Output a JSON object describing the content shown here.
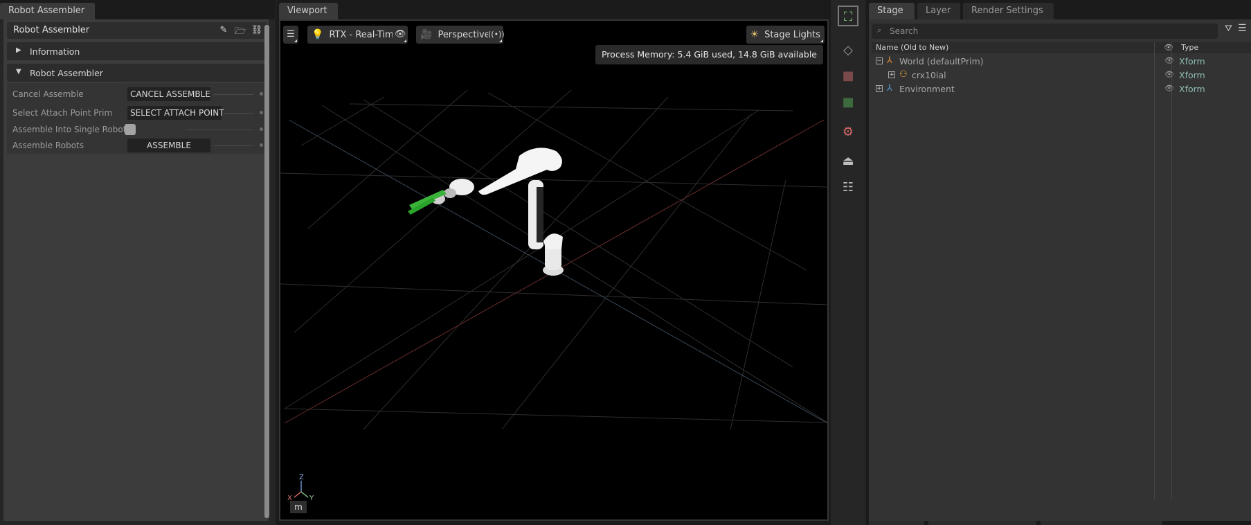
{
  "left_panel": {
    "tab": "Robot Assembler",
    "title": "Robot Assembler",
    "icons": [
      "edit-icon",
      "folder-open-icon",
      "link-icon"
    ],
    "sections": {
      "information": "Information",
      "robot_assembler": "Robot Assembler"
    },
    "rows": [
      {
        "label": "Cancel Assemble",
        "button": "CANCEL ASSEMBLE"
      },
      {
        "label": "Select Attach Point Prim",
        "button": "SELECT ATTACH POINT"
      },
      {
        "label": "Assemble Into Single Robot",
        "checked": false
      },
      {
        "label": "Assemble Robots",
        "button": "ASSEMBLE"
      }
    ]
  },
  "viewport": {
    "tab": "Viewport",
    "render_mode": "RTX - Real-Time",
    "camera": "Perspective",
    "lights": "Stage Lights",
    "memory": "Process Memory: 5.4 GiB used, 14.8 GiB available",
    "unit": "m",
    "axes": {
      "z": "Z",
      "x": "X",
      "y": "Y"
    }
  },
  "stage": {
    "tabs": [
      "Stage",
      "Layer",
      "Render Settings"
    ],
    "search_placeholder": "Search",
    "columns": {
      "name": "Name (Old to New)",
      "type": "Type"
    },
    "rows": [
      {
        "name": "World (defaultPrim)",
        "type": "Xform",
        "expander": "−"
      },
      {
        "name": "crx10ial",
        "type": "Xform",
        "expander": "+"
      },
      {
        "name": "Environment",
        "type": "Xform",
        "expander": "+"
      }
    ]
  },
  "colors": {
    "accent_green": "#76b900",
    "type_text": "#8fbcb3",
    "grid_red": "#8a3a3a"
  }
}
